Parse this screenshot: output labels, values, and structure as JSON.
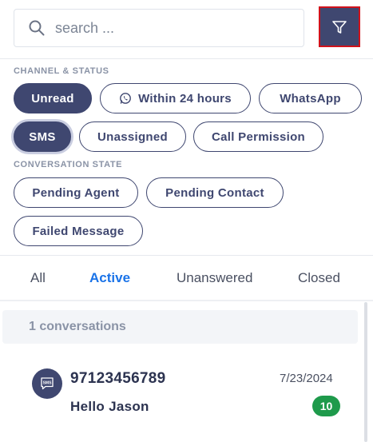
{
  "search": {
    "placeholder": "search ..."
  },
  "filter": {
    "icon": "filter-icon"
  },
  "sections": {
    "channel_status": "CHANNEL & STATUS",
    "conversation_state": "CONVERSATION STATE"
  },
  "chips": {
    "unread": "Unread",
    "within_24": "Within 24 hours",
    "whatsapp": "WhatsApp",
    "sms": "SMS",
    "unassigned": "Unassigned",
    "call_permission": "Call Permission",
    "pending_agent": "Pending Agent",
    "pending_contact": "Pending Contact",
    "failed_message": "Failed Message"
  },
  "selected_chips": [
    "Unread",
    "SMS"
  ],
  "tabs": [
    {
      "label": "All"
    },
    {
      "label": "Active"
    },
    {
      "label": "Unanswered"
    },
    {
      "label": "Closed"
    }
  ],
  "active_tab": "Active",
  "conversations": {
    "count_label": "1 conversations",
    "items": [
      {
        "phone": "97123456789",
        "date": "7/23/2024",
        "message": "Hello Jason",
        "unread": "10",
        "channel_icon": "sms-icon"
      }
    ]
  },
  "colors": {
    "primary": "#3f4770",
    "active_tab": "#1a73e8",
    "badge": "#1e9a4b",
    "highlight_border": "#d0121b"
  }
}
